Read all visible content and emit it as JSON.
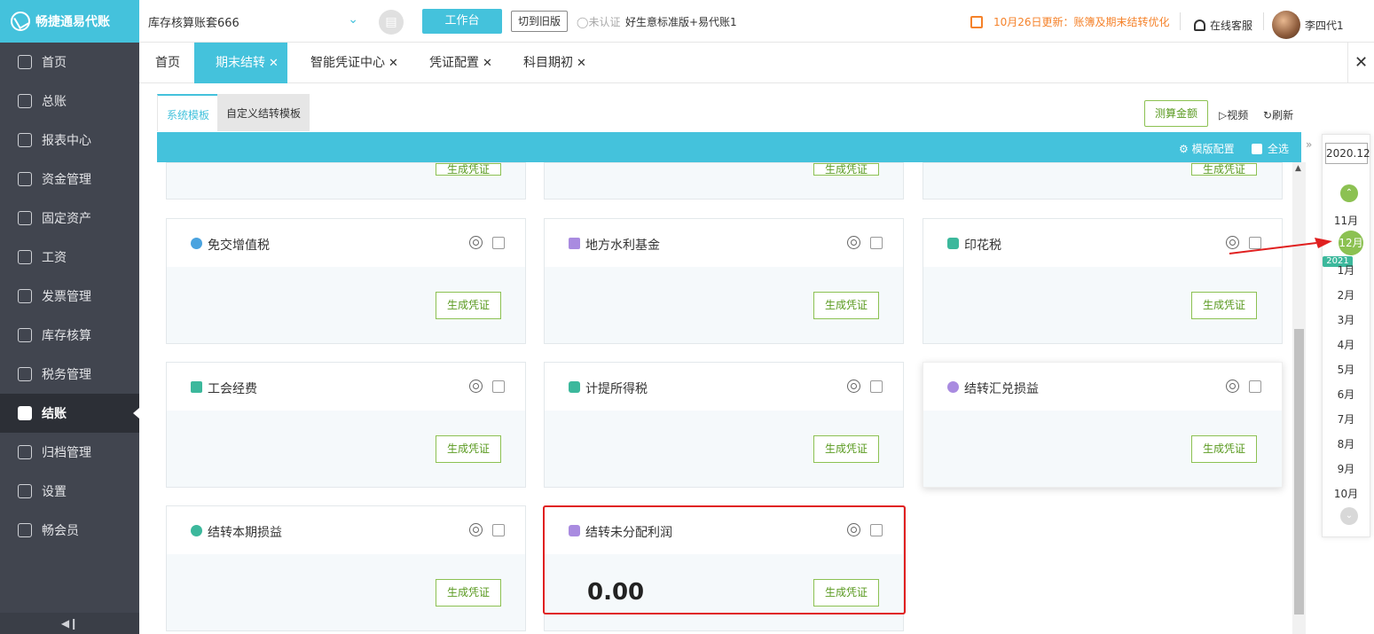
{
  "app": {
    "logo_text": "畅捷通易代账"
  },
  "topbar": {
    "account_set": "库存核算账套666",
    "workbench_label": "工作台",
    "old_version_label": "切到旧版",
    "unverified": "未认证",
    "edition": "好生意标准版+易代账1",
    "notice": "10月26日更新：账簿及期末结转优化",
    "support": "在线客服",
    "username": "李四代1"
  },
  "sidebar": {
    "items": [
      {
        "label": "首页",
        "icon": "home-icon"
      },
      {
        "label": "总账",
        "icon": "ledger-icon"
      },
      {
        "label": "报表中心",
        "icon": "chart-icon"
      },
      {
        "label": "资金管理",
        "icon": "money-icon"
      },
      {
        "label": "固定资产",
        "icon": "asset-icon"
      },
      {
        "label": "工资",
        "icon": "salary-icon"
      },
      {
        "label": "发票管理",
        "icon": "invoice-icon"
      },
      {
        "label": "库存核算",
        "icon": "warehouse-icon"
      },
      {
        "label": "税务管理",
        "icon": "tax-icon"
      },
      {
        "label": "结账",
        "icon": "closing-icon"
      },
      {
        "label": "归档管理",
        "icon": "archive-icon"
      },
      {
        "label": "设置",
        "icon": "gear-icon"
      },
      {
        "label": "畅会员",
        "icon": "vip-icon"
      }
    ],
    "active_index": 9
  },
  "tabs": [
    {
      "label": "首页",
      "closable": false
    },
    {
      "label": "期末结转",
      "closable": true,
      "active": true
    },
    {
      "label": "智能凭证中心",
      "closable": true
    },
    {
      "label": "凭证配置",
      "closable": true
    },
    {
      "label": "科目期初",
      "closable": true
    }
  ],
  "subtabs": {
    "system": "系统模板",
    "custom": "自定义结转模板"
  },
  "toolbar": {
    "calc_label": "测算金额",
    "video_label": "视频",
    "refresh_label": "刷新"
  },
  "bar": {
    "config_label": "模版配置",
    "select_all_label": "全选"
  },
  "generate_label": "生成凭证",
  "cards": [
    {
      "title": "免交增值税",
      "icon_color": "#4aa3df"
    },
    {
      "title": "地方水利基金",
      "icon_color": "#a98be0"
    },
    {
      "title": "印花税",
      "icon_color": "#3cb89c"
    },
    {
      "title": "工会经费",
      "icon_color": "#3cb89c"
    },
    {
      "title": "计提所得税",
      "icon_color": "#3cb89c"
    },
    {
      "title": "结转汇兑损益",
      "icon_color": "#a98be0"
    },
    {
      "title": "结转本期损益",
      "icon_color": "#3cb89c"
    },
    {
      "title": "结转未分配利润",
      "icon_color": "#a98be0",
      "amount": "0.00"
    }
  ],
  "period": {
    "year": "2020.12",
    "months": [
      "11月",
      "12月",
      "1月",
      "2月",
      "3月",
      "4月",
      "5月",
      "6月",
      "7月",
      "8月",
      "9月",
      "10月"
    ],
    "current": "12月",
    "next_year_badge": "2021"
  },
  "colors": {
    "accent": "#44c2dc",
    "green": "#8cc152",
    "sidebar": "#41454f",
    "highlight": "#e02020"
  }
}
